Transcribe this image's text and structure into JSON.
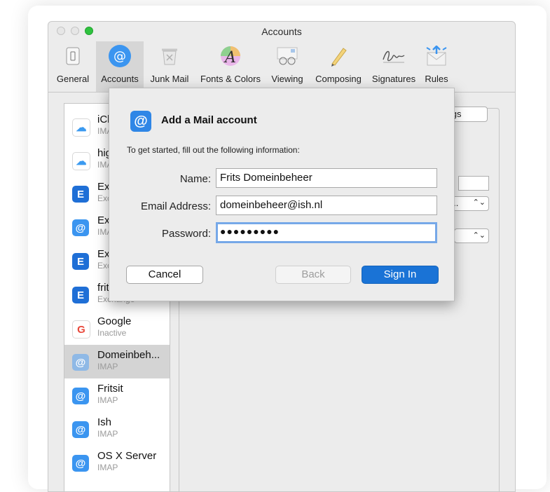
{
  "window": {
    "title": "Accounts",
    "toolbar": [
      {
        "label": "General",
        "icon": "switch-icon"
      },
      {
        "label": "Accounts",
        "icon": "at-icon"
      },
      {
        "label": "Junk Mail",
        "icon": "trash-icon"
      },
      {
        "label": "Fonts & Colors",
        "icon": "font-icon"
      },
      {
        "label": "Viewing",
        "icon": "glasses-icon"
      },
      {
        "label": "Composing",
        "icon": "pencil-icon"
      },
      {
        "label": "Signatures",
        "icon": "signature-icon"
      },
      {
        "label": "Rules",
        "icon": "rules-icon"
      }
    ],
    "active_tab": "Accounts"
  },
  "accounts": [
    {
      "name": "iCl",
      "type": "IMA",
      "icon": "icloud-icon"
    },
    {
      "name": "hig",
      "type": "IMA",
      "icon": "icloud-icon"
    },
    {
      "name": "Ex",
      "type": "Exc",
      "icon": "exchange-icon"
    },
    {
      "name": "Ex",
      "type": "IMA",
      "icon": "at-icon"
    },
    {
      "name": "Ex",
      "type": "Exc",
      "icon": "exchange-icon"
    },
    {
      "name": "frit",
      "type": "Exchange",
      "icon": "exchange-icon"
    },
    {
      "name": "Google",
      "type": "Inactive",
      "icon": "google-icon"
    },
    {
      "name": "Domeinbeh...",
      "type": "IMAP",
      "icon": "at-icon",
      "selected": true
    },
    {
      "name": "Fritsit",
      "type": "IMAP",
      "icon": "at-icon"
    },
    {
      "name": "Ish",
      "type": "IMAP",
      "icon": "at-icon"
    },
    {
      "name": "OS X Server",
      "type": "IMAP",
      "icon": "at-icon"
    }
  ],
  "detail": {
    "settings_button": "tings",
    "popup1_value": "s...",
    "popup1_arrow": "⌃⌄",
    "popup2_arrow": "⌃⌄"
  },
  "sheet": {
    "title": "Add a Mail account",
    "instructions": "To get started, fill out the following information:",
    "name_label": "Name:",
    "name_value": "Frits Domeinbeheer",
    "email_label": "Email Address:",
    "email_value": "domeinbeheer@ish.nl",
    "password_label": "Password:",
    "password_value": "●●●●●●●●●",
    "cancel_label": "Cancel",
    "back_label": "Back",
    "signin_label": "Sign In"
  },
  "colors": {
    "accent": "#1a73d6",
    "at_icon": "#2f86e6",
    "zoom_button": "#2fc23f"
  }
}
